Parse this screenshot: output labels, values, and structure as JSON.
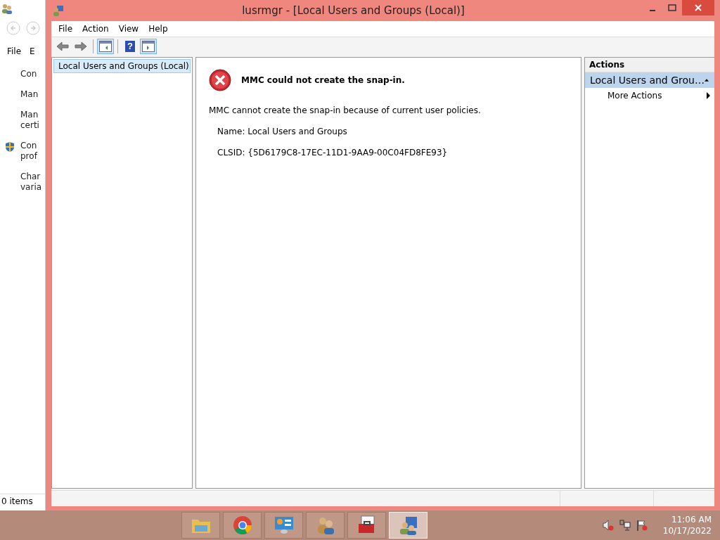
{
  "background_window": {
    "menu": [
      "File",
      "E"
    ],
    "items": [
      {
        "lines": [
          "Con"
        ],
        "shield": false
      },
      {
        "lines": [
          "Man"
        ],
        "shield": false
      },
      {
        "lines": [
          "Man",
          "certi"
        ],
        "shield": false
      },
      {
        "lines": [
          "Con",
          "prof"
        ],
        "shield": true
      },
      {
        "lines": [
          "Char",
          "varia"
        ],
        "shield": false
      }
    ],
    "status": "0 items"
  },
  "window": {
    "title": "lusrmgr - [Local Users and Groups (Local)]"
  },
  "menu": [
    "File",
    "Action",
    "View",
    "Help"
  ],
  "toolbar": [
    {
      "kind": "back",
      "pressed": false
    },
    {
      "kind": "forward",
      "pressed": false
    },
    {
      "kind": "tree",
      "pressed": true
    },
    {
      "kind": "help",
      "pressed": false,
      "glyph": "?"
    },
    {
      "kind": "actionpane",
      "pressed": true
    }
  ],
  "tree": [
    {
      "label": "Local Users and Groups (Local)",
      "selected": true
    }
  ],
  "message": {
    "heading": "MMC could not create the snap-in.",
    "body": "MMC cannot create the snap-in because of current user policies.",
    "name": "Name: Local Users and Groups",
    "clsid": "CLSID: {5D6179C8-17EC-11D1-9AA9-00C04FD8FE93}"
  },
  "actions": {
    "header": "Actions",
    "group": "Local Users and Grou…",
    "expanded": true,
    "items": [
      {
        "label": "More Actions"
      }
    ]
  },
  "taskbar": {
    "apps": [
      {
        "kind": "folder",
        "selected": false
      },
      {
        "kind": "chrome",
        "selected": false
      },
      {
        "kind": "panel",
        "selected": false
      },
      {
        "kind": "users",
        "selected": false
      },
      {
        "kind": "toolbox",
        "selected": false
      },
      {
        "kind": "mmc",
        "selected": true
      }
    ],
    "time": "11:06 AM",
    "date": "10/17/2022"
  }
}
